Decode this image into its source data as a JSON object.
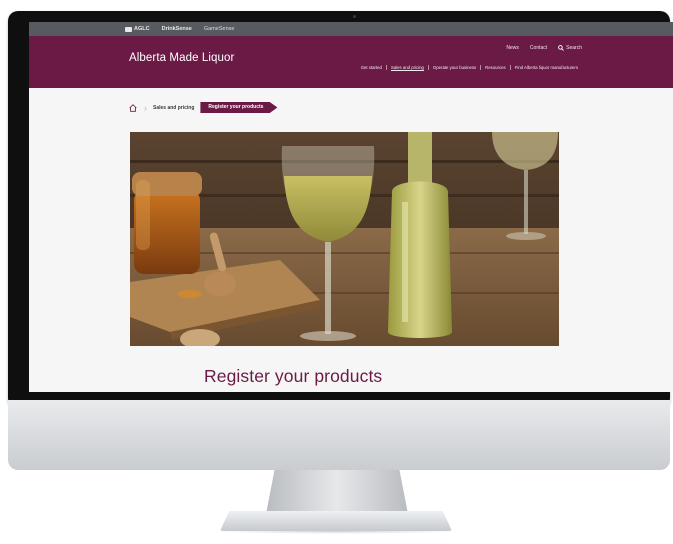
{
  "utility_bar": {
    "items": [
      "AGLC",
      "DrinkSense",
      "GameSense"
    ]
  },
  "header": {
    "brand": "Alberta Made Liquor",
    "utility_links": [
      "News",
      "Contact",
      "Search"
    ],
    "nav": [
      "Get started",
      "Sales and pricing",
      "Operate your business",
      "Resources",
      "Find Alberta liquor manufacturers"
    ],
    "active_nav": "Sales and pricing"
  },
  "breadcrumb": {
    "parent": "Sales and pricing",
    "current": "Register your products"
  },
  "hero": {
    "subject": "honey jar, wine glass and bottle on wooden table"
  },
  "page": {
    "title": "Register your products"
  },
  "colors": {
    "brand": "#6b1a45",
    "utility_bar": "#575a5f"
  }
}
